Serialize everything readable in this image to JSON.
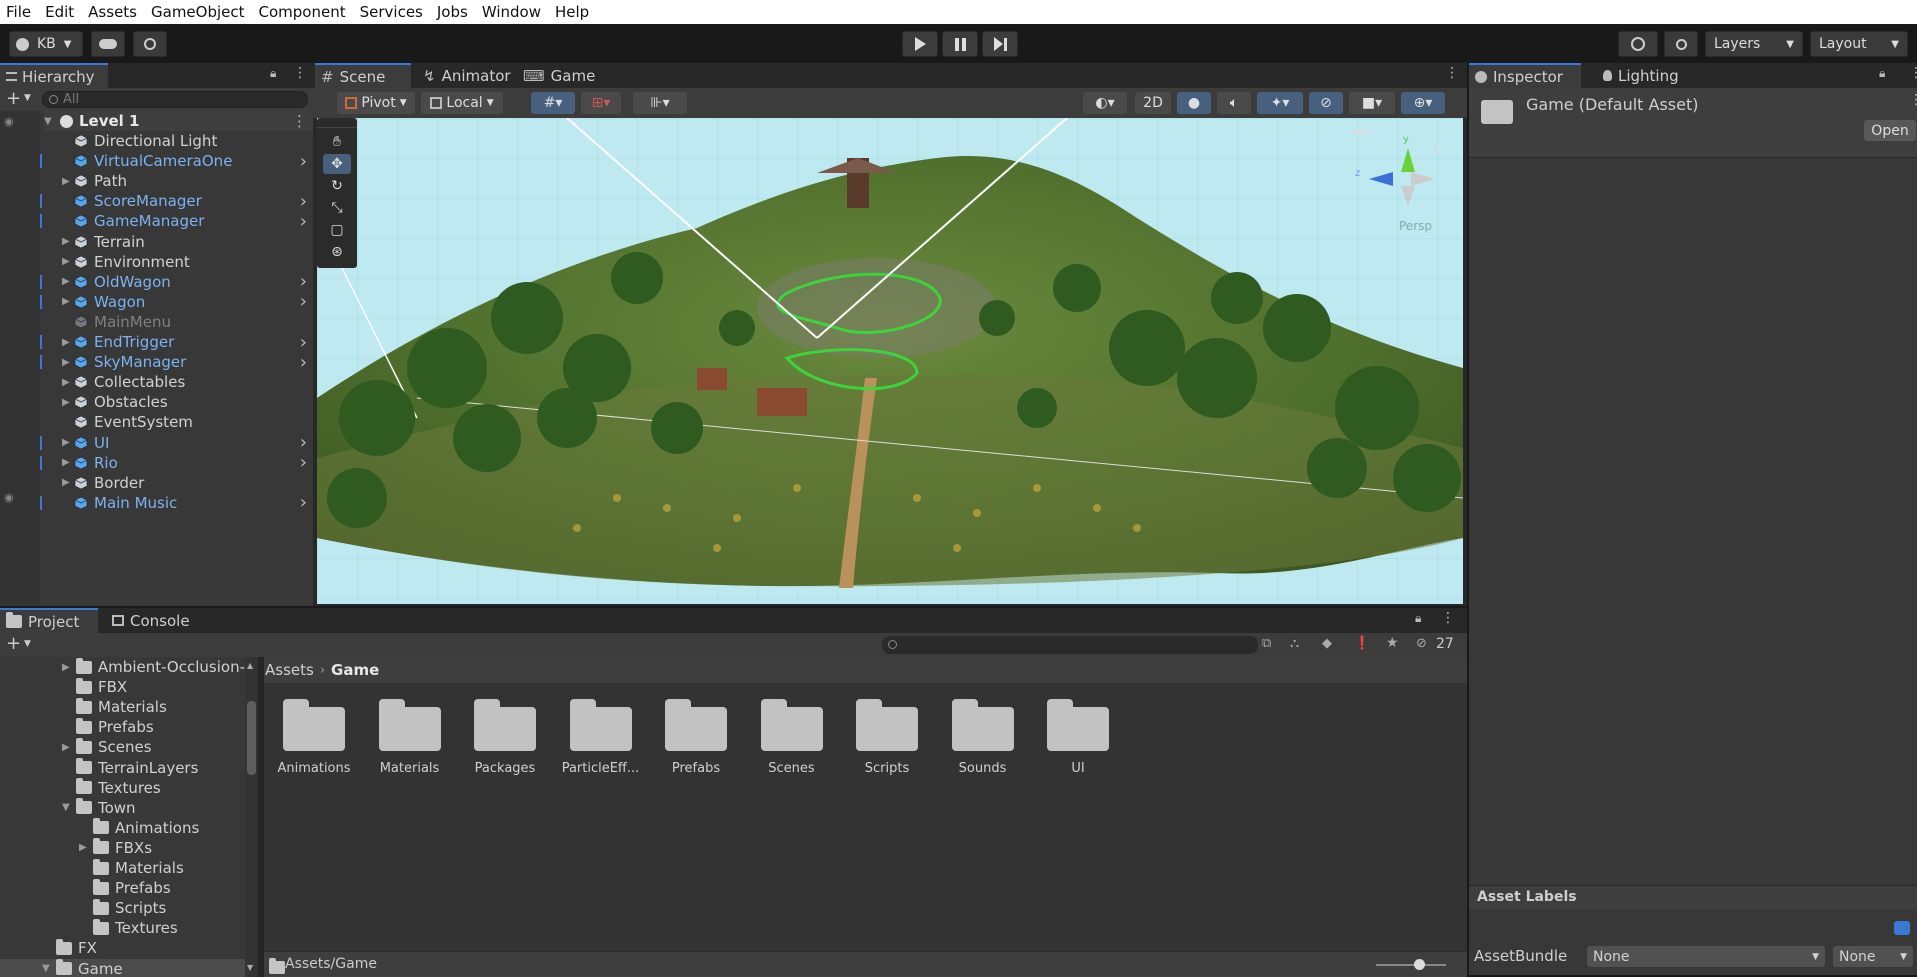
{
  "menu": [
    "File",
    "Edit",
    "Assets",
    "GameObject",
    "Component",
    "Services",
    "Jobs",
    "Window",
    "Help"
  ],
  "toolbar": {
    "account": "KB",
    "layers": "Layers",
    "layout": "Layout"
  },
  "hierarchy": {
    "tab": "Hierarchy",
    "search_placeholder": "All",
    "scene": "Level 1",
    "items": [
      {
        "label": "Directional Light",
        "style": "normal",
        "expand": false,
        "chevron": false
      },
      {
        "label": "VirtualCameraOne",
        "style": "blue",
        "expand": false,
        "chevron": true
      },
      {
        "label": "Path",
        "style": "normal",
        "expand": true,
        "chevron": false
      },
      {
        "label": "ScoreManager",
        "style": "blue",
        "expand": false,
        "chevron": true
      },
      {
        "label": "GameManager",
        "style": "blue",
        "expand": false,
        "chevron": true
      },
      {
        "label": "Terrain",
        "style": "normal",
        "expand": true,
        "chevron": false
      },
      {
        "label": "Environment",
        "style": "normal",
        "expand": true,
        "chevron": false
      },
      {
        "label": "OldWagon",
        "style": "blue",
        "expand": true,
        "chevron": true
      },
      {
        "label": "Wagon",
        "style": "blue",
        "expand": true,
        "chevron": true
      },
      {
        "label": "MainMenu",
        "style": "grey",
        "expand": false,
        "chevron": false
      },
      {
        "label": "EndTrigger",
        "style": "blue",
        "expand": true,
        "chevron": true
      },
      {
        "label": "SkyManager",
        "style": "blue",
        "expand": true,
        "chevron": true
      },
      {
        "label": "Collectables",
        "style": "normal",
        "expand": true,
        "chevron": false
      },
      {
        "label": "Obstacles",
        "style": "normal",
        "expand": true,
        "chevron": false
      },
      {
        "label": "EventSystem",
        "style": "normal",
        "expand": false,
        "chevron": false
      },
      {
        "label": "UI",
        "style": "blue",
        "expand": true,
        "chevron": true
      },
      {
        "label": "Rio",
        "style": "blue",
        "expand": true,
        "chevron": true
      },
      {
        "label": "Border",
        "style": "normal",
        "expand": true,
        "chevron": false
      },
      {
        "label": "Main Music",
        "style": "blue",
        "expand": false,
        "chevron": true
      }
    ]
  },
  "scene_tabs": [
    "Scene",
    "Animator",
    "Game"
  ],
  "scene_toolbar": {
    "pivot": "Pivot",
    "local": "Local",
    "mode_2d": "2D"
  },
  "gizmo": {
    "persp": "Persp",
    "y": "y",
    "x": "x",
    "z": "z"
  },
  "inspector": {
    "tabs": [
      "Inspector",
      "Lighting"
    ],
    "title": "Game (Default Asset)",
    "open_label": "Open",
    "asset_labels": "Asset Labels",
    "asset_bundle_label": "AssetBundle",
    "bundle_value": "None",
    "variant_value": "None"
  },
  "project": {
    "tabs": [
      "Project",
      "Console"
    ],
    "hidden_count": "27",
    "tree": [
      {
        "label": "Ambient-Occlusion-",
        "indent": 1,
        "arrow": "right"
      },
      {
        "label": "FBX",
        "indent": 1,
        "arrow": ""
      },
      {
        "label": "Materials",
        "indent": 1,
        "arrow": ""
      },
      {
        "label": "Prefabs",
        "indent": 1,
        "arrow": ""
      },
      {
        "label": "Scenes",
        "indent": 1,
        "arrow": "right"
      },
      {
        "label": "TerrainLayers",
        "indent": 1,
        "arrow": ""
      },
      {
        "label": "Textures",
        "indent": 1,
        "arrow": ""
      },
      {
        "label": "Town",
        "indent": 1,
        "arrow": "down"
      },
      {
        "label": "Animations",
        "indent": 2,
        "arrow": ""
      },
      {
        "label": "FBXs",
        "indent": 2,
        "arrow": "right"
      },
      {
        "label": "Materials",
        "indent": 2,
        "arrow": ""
      },
      {
        "label": "Prefabs",
        "indent": 2,
        "arrow": ""
      },
      {
        "label": "Scripts",
        "indent": 2,
        "arrow": ""
      },
      {
        "label": "Textures",
        "indent": 2,
        "arrow": ""
      },
      {
        "label": "FX",
        "indent": 0,
        "arrow": ""
      },
      {
        "label": "Game",
        "indent": 0,
        "arrow": "down",
        "selected": true
      }
    ],
    "breadcrumb": [
      "Assets",
      "Game"
    ],
    "folders": [
      "Animations",
      "Materials",
      "Packages",
      "ParticleEff...",
      "Prefabs",
      "Scenes",
      "Scripts",
      "Sounds",
      "UI"
    ],
    "footer_path": "Assets/Game"
  }
}
